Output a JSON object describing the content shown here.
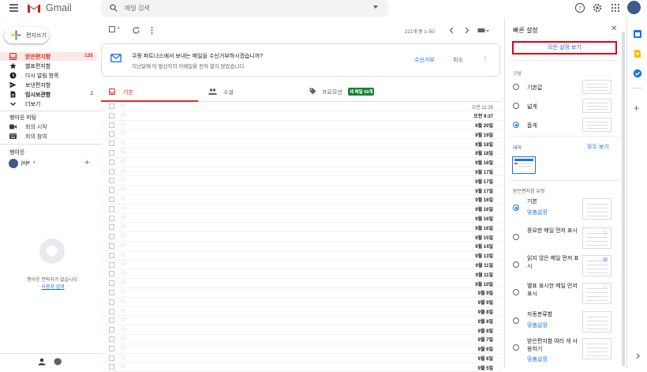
{
  "header": {
    "app_name": "Gmail",
    "search_placeholder": "메일 검색"
  },
  "compose": {
    "label": "편지쓰기"
  },
  "nav": [
    {
      "label": "받은편지함",
      "count": "135",
      "icon": "inbox-icon",
      "active": true
    },
    {
      "label": "별표편지함",
      "count": "",
      "icon": "star-icon"
    },
    {
      "label": "다시 알림 항목",
      "count": "",
      "icon": "clock-icon"
    },
    {
      "label": "보낸편지함",
      "count": "",
      "icon": "send-icon"
    },
    {
      "label": "임시보관함",
      "count": "2",
      "icon": "draft-icon",
      "bold": true
    },
    {
      "label": "더보기",
      "count": "",
      "icon": "chevron-down-icon"
    }
  ],
  "meet": {
    "title": "행아웃 미팅",
    "items": [
      "회의 시작",
      "회의 참여"
    ]
  },
  "hangouts": {
    "title": "행아웃",
    "user": "joje",
    "empty_text": "행아웃 연락처가 없습니다.",
    "find_link": "사용자 검색"
  },
  "toolbar": {
    "pager": "221개 중 1–50"
  },
  "banner": {
    "title": "쿠팡 파트너스에서 보내는 메일을 수신거부하시겠습니까?",
    "subtitle": "지난달에 이 발신자의 이메일을 전혀 열지 않았습니다.",
    "unsubscribe": "수신거부",
    "cancel": "취소"
  },
  "tabs": [
    {
      "label": "기본"
    },
    {
      "label": "소셜"
    },
    {
      "label": "프로모션",
      "badge": "새 메일 50개"
    }
  ],
  "rows": [
    {
      "date": "오전 11:25",
      "unread": false
    },
    {
      "date": "오전 9:37",
      "unread": true
    },
    {
      "date": "9월 20일",
      "unread": true
    },
    {
      "date": "9월 19일",
      "unread": true
    },
    {
      "date": "9월 18일",
      "unread": true
    },
    {
      "date": "9월 18일",
      "unread": true
    },
    {
      "date": "9월 18일",
      "unread": true
    },
    {
      "date": "9월 17일",
      "unread": true
    },
    {
      "date": "9월 17일",
      "unread": true
    },
    {
      "date": "9월 17일",
      "unread": true
    },
    {
      "date": "9월 16일",
      "unread": true
    },
    {
      "date": "9월 16일",
      "unread": true
    },
    {
      "date": "9월 16일",
      "unread": true
    },
    {
      "date": "9월 16일",
      "unread": true
    },
    {
      "date": "9월 15일",
      "unread": true
    },
    {
      "date": "9월 14일",
      "unread": true
    },
    {
      "date": "9월 13일",
      "unread": true
    },
    {
      "date": "9월 11일",
      "unread": true
    },
    {
      "date": "9월 11일",
      "unread": true
    },
    {
      "date": "9월 10일",
      "unread": true
    },
    {
      "date": "9월 9일",
      "unread": true
    },
    {
      "date": "9월 9일",
      "unread": true
    },
    {
      "date": "9월 8일",
      "unread": true
    },
    {
      "date": "9월 8일",
      "unread": true
    },
    {
      "date": "9월 8일",
      "unread": true
    },
    {
      "date": "9월 7일",
      "unread": true
    },
    {
      "date": "9월 6일",
      "unread": true
    },
    {
      "date": "9월 6일",
      "unread": true
    },
    {
      "date": "9월 5일",
      "unread": true
    }
  ],
  "quick_settings": {
    "title": "빠른 설정",
    "all_settings": "모든 설정 보기",
    "density_title": "구성",
    "density": [
      "기본값",
      "넓게",
      "좁게"
    ],
    "density_selected": 2,
    "theme_title": "테마",
    "theme_all": "모두 보기",
    "inbox_type_title": "받은편지함 유형",
    "inbox_types": [
      {
        "label": "기본",
        "link": "맞춤설정",
        "selected": true
      },
      {
        "label": "중요한 메일 먼저 표시",
        "link": ""
      },
      {
        "label": "읽지 않은 메일 먼저 표시",
        "link": ""
      },
      {
        "label": "별표 표시한 메일 먼저 표시",
        "link": ""
      },
      {
        "label": "자동분류함",
        "link": "맞춤설정"
      },
      {
        "label": "받은편지함 여러 개 사용하기",
        "link": "맞춤설정"
      }
    ]
  },
  "colors": {
    "accent": "#1a73e8",
    "gmail_red": "#d93025",
    "highlight_border": "#e0001a",
    "promo_badge": "#188038"
  }
}
